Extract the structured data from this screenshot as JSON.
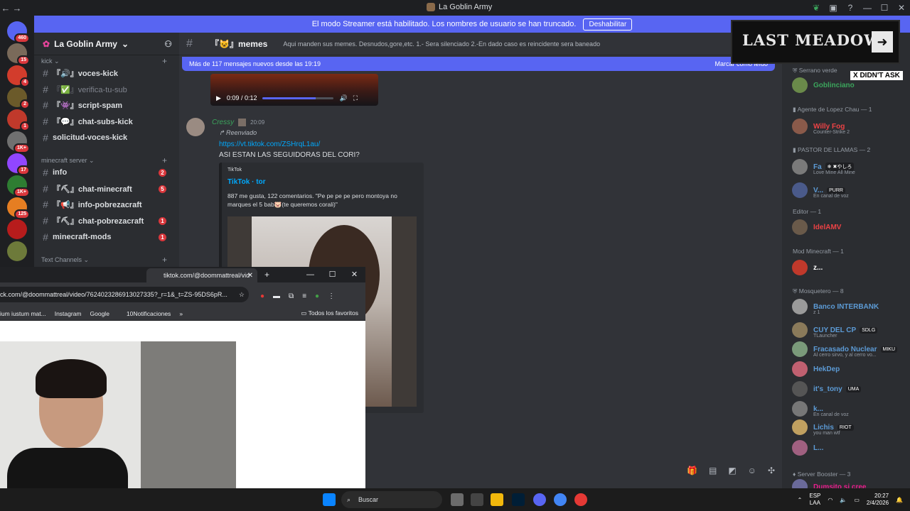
{
  "window": {
    "title": "Discord",
    "back_icon": "←",
    "forward_icon": "→"
  },
  "streamer_banner": {
    "text": "El modo Streamer está habilitado. Los nombres de usuario se han truncado.",
    "button": "Deshabilitar"
  },
  "servers": [
    {
      "badge": "460",
      "color": "#5865f2"
    },
    {
      "badge": "15",
      "color": "#7a6a5a"
    },
    {
      "badge": "4",
      "color": "#d23c2c"
    },
    {
      "badge": "2",
      "color": "#6b5a2a"
    },
    {
      "badge": "1",
      "color": "#c0392b"
    },
    {
      "badge": "1K+",
      "color": "#707070"
    },
    {
      "badge": "17",
      "color": "#9146ff"
    },
    {
      "badge": "1K+",
      "color": "#2e7d32"
    },
    {
      "badge": "125",
      "color": "#e67e22"
    },
    {
      "badge": "",
      "color": "#b71c1c"
    },
    {
      "badge": "",
      "color": "#6d7a3a"
    }
  ],
  "guild": {
    "name": "La Goblin Army"
  },
  "categories": {
    "kick": "kick",
    "minecraft": "minecraft server",
    "text": "Text Channels"
  },
  "channels": [
    {
      "name": "『🔊』voces-kick",
      "muted": false,
      "badge": ""
    },
    {
      "name": "『✅』verifica-tu-sub",
      "muted": true,
      "badge": ""
    },
    {
      "name": "『👾』script-spam",
      "muted": false,
      "badge": ""
    },
    {
      "name": "『💬』chat-subs-kick",
      "muted": false,
      "badge": ""
    },
    {
      "name": "solicitud-voces-kick",
      "muted": false,
      "badge": ""
    },
    {
      "name": "info",
      "muted": false,
      "badge": "2",
      "prefix": "『📢』"
    },
    {
      "name": "『⛏』chat-minecraft",
      "muted": false,
      "badge": "5"
    },
    {
      "name": "『📢』info-pobrezacraft",
      "muted": false,
      "badge": ""
    },
    {
      "name": "『⛏』chat-pobrezacraft",
      "muted": false,
      "badge": "1"
    },
    {
      "name": "minecraft-mods",
      "muted": false,
      "badge": "1"
    }
  ],
  "channel_header": {
    "name": "『😺』memes",
    "topic": "Aqui manden sus memes. Desnudos,gore,etc. 1.- Sera silenciado 2.-En dado caso es reincidente sera baneado"
  },
  "new_messages": {
    "text": "Más de 117 mensajes nuevos desde las 19:19",
    "action": "Marcar como leído"
  },
  "video": {
    "time": "0:09 / 0:12",
    "progress": 0.75
  },
  "message": {
    "author": "Cressy",
    "time": "20:09",
    "forwarded": "Reenviado",
    "link": "https://vt.tiktok.com/ZSHrqL1au/",
    "text": "ASI ESTAN LAS SEGUIDORAS DEL CORI?"
  },
  "embed": {
    "provider": "TikTok",
    "title": "TikTok · tor",
    "description": "887 me gusta, 122 comentarios. \"Pe pe pe pe pero montoya no marques el 5 bab🐷(te queremos corali)\""
  },
  "overlay": {
    "title": "LAST MEADOW",
    "didnt_ask": "X DIDN'T ASK"
  },
  "members": {
    "categories": {
      "agente": "Agente de Lopez Chau — 1",
      "pastor": "PASTOR DE LLAMAS — 2",
      "editor": "Editor — 1",
      "mod": "Mod Minecraft — 1",
      "mosquetero": "Mosquetero — 8",
      "booster": "Server Booster — 3",
      "serrano": "Serrano verde"
    },
    "list": [
      {
        "name": "Goblinciano",
        "status": "",
        "color": "#3ba55c",
        "tag": ""
      },
      {
        "name": "Willy Fog",
        "status": "Counter-Strike 2",
        "color": "#ed4245",
        "tag": ""
      },
      {
        "name": "Fa",
        "status": "Love Mine All Mine",
        "color": "#5c9bd6",
        "tag": "❄ ✖やしろ"
      },
      {
        "name": "V...",
        "status": "En canal de voz",
        "color": "#5c9bd6",
        "tag": "PURR"
      },
      {
        "name": "IdelAMV",
        "status": "",
        "color": "#ed4245",
        "tag": ""
      },
      {
        "name": "z...",
        "status": "",
        "color": "#ffffff",
        "tag": ""
      },
      {
        "name": "Banco INTERBANK",
        "status": "z 1",
        "color": "#5c9bd6",
        "tag": ""
      },
      {
        "name": "CUY DEL CP",
        "status": "TLauncher",
        "color": "#5c9bd6",
        "tag": "SDLG"
      },
      {
        "name": "Fracasado Nuclear",
        "status": "Al cerro sirvo, y al cerro vo...",
        "color": "#5c9bd6",
        "tag": "MIKU"
      },
      {
        "name": "HekDep",
        "status": "",
        "color": "#5c9bd6",
        "tag": ""
      },
      {
        "name": "it's_tony",
        "status": "",
        "color": "#5c9bd6",
        "tag": "UMA"
      },
      {
        "name": "k...",
        "status": "En canal de voz",
        "color": "#5c9bd6",
        "tag": ""
      },
      {
        "name": "Lichis",
        "status": "you man wtf",
        "color": "#5c9bd6",
        "tag": "RIOT"
      },
      {
        "name": "L...",
        "status": "",
        "color": "#5c9bd6",
        "tag": ""
      },
      {
        "name": "Dumsito si cree",
        "status": "",
        "color": "#e91e8c",
        "tag": ""
      }
    ]
  },
  "browser": {
    "tab_title": "tiktok.com/@doommattreal/vid",
    "url": "ck.com/@doommattreal/video/7624023286913027335?_r=1&_t=ZS-95DS6pR...",
    "bookmarks": [
      "ium iustum mat...",
      "Instagram",
      "Google",
      "",
      "10Notificaciones"
    ],
    "all_bookmarks": "Todos los favoritos"
  },
  "taskbar": {
    "search": "Buscar",
    "lang_1": "ESP",
    "lang_2": "LAA",
    "time": "20:27",
    "date": "2/4/2026"
  }
}
